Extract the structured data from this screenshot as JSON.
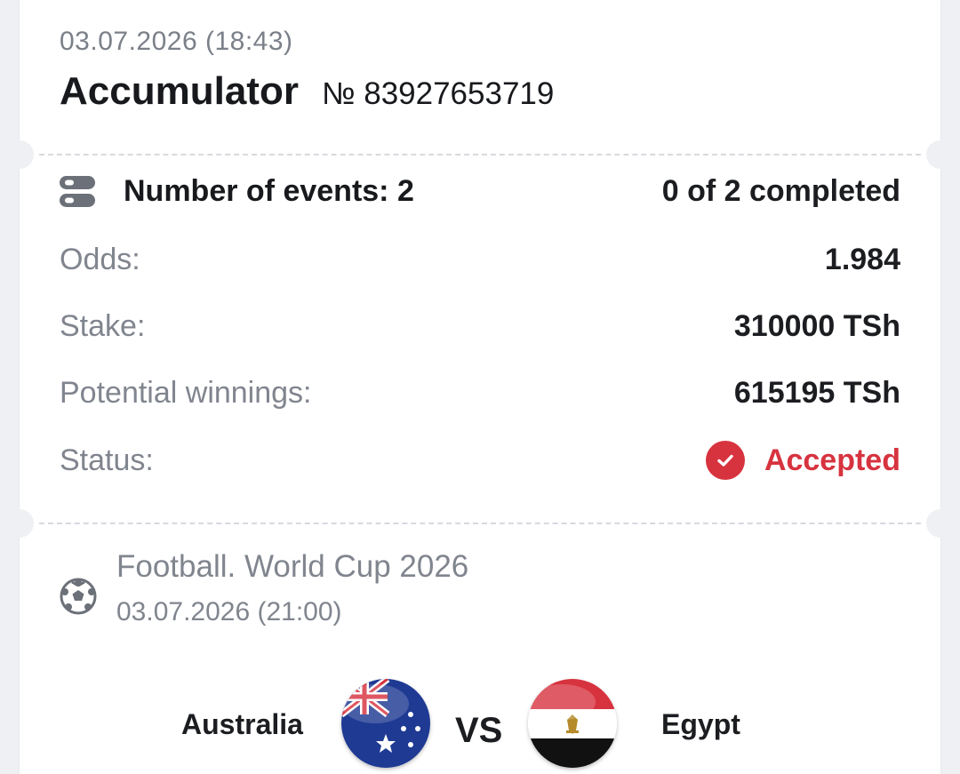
{
  "header": {
    "datetime": "03.07.2026 (18:43)",
    "bet_type": "Accumulator",
    "bet_number": "№ 83927653719"
  },
  "summary": {
    "events_label": "Number of events: 2",
    "events_progress": "0 of 2 completed",
    "odds_label": "Odds:",
    "odds_value": "1.984",
    "stake_label": "Stake:",
    "stake_value": "310000 TSh",
    "winnings_label": "Potential winnings:",
    "winnings_value": "615195 TSh",
    "status_label": "Status:",
    "status_value": "Accepted"
  },
  "event": {
    "icon": "football-icon",
    "title": "Football. World Cup 2026",
    "datetime": "03.07.2026 (21:00)",
    "home_team": "Australia",
    "away_team": "Egypt",
    "vs_label": "VS"
  },
  "colors": {
    "accent_red": "#d7333f",
    "muted_text": "#80858e",
    "background": "#eef0f3"
  }
}
